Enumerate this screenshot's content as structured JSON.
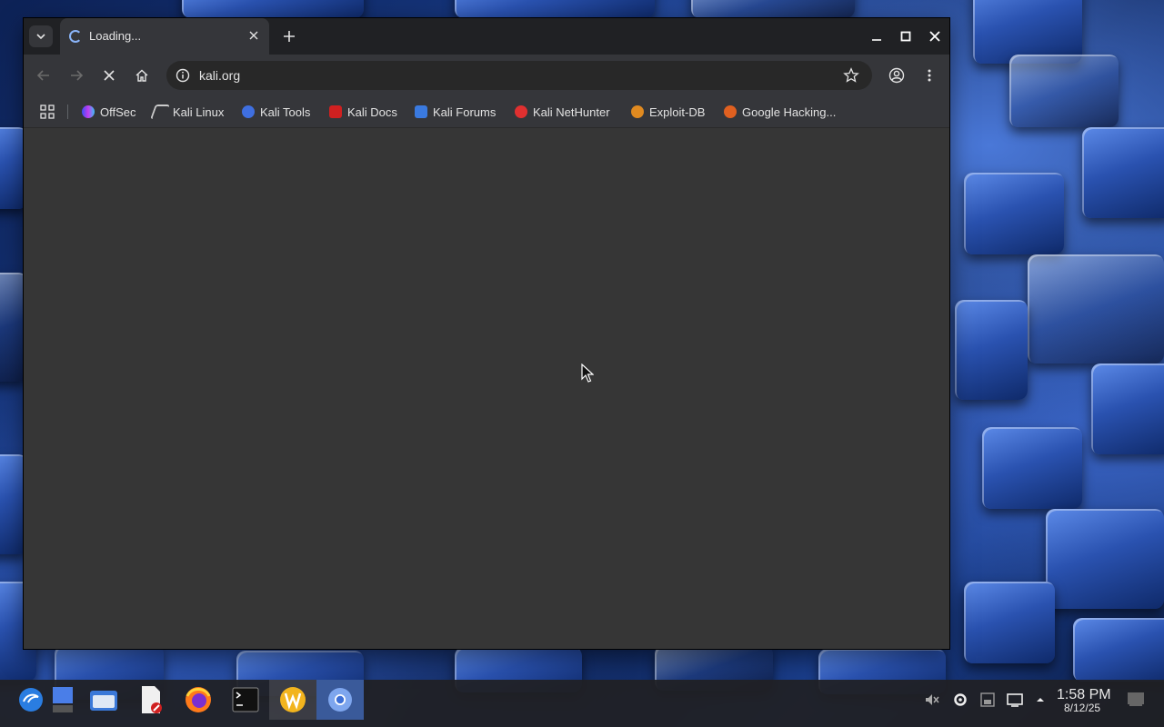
{
  "browser": {
    "tab": {
      "title": "Loading...",
      "close_icon": "close-icon"
    },
    "address": {
      "url": "kali.org"
    },
    "bookmarks": [
      {
        "label": "OffSec",
        "color": "#4a6cf7"
      },
      {
        "label": "Kali Linux",
        "color": "#cccccc"
      },
      {
        "label": "Kali Tools",
        "color": "#3f6fe0"
      },
      {
        "label": "Kali Docs",
        "color": "#d02020"
      },
      {
        "label": "Kali Forums",
        "color": "#3a7ae0"
      },
      {
        "label": "Kali NetHunter",
        "color": "#e03030"
      },
      {
        "label": "Exploit-DB",
        "color": "#e08a20"
      },
      {
        "label": "Google Hacking...",
        "color": "#e06020"
      }
    ]
  },
  "taskbar": {
    "apps": [
      {
        "name": "kali-menu-icon"
      },
      {
        "name": "show-desktop-icon"
      },
      {
        "name": "file-manager-icon"
      },
      {
        "name": "text-editor-icon"
      },
      {
        "name": "firefox-icon"
      },
      {
        "name": "terminal-icon"
      },
      {
        "name": "app-w-icon"
      },
      {
        "name": "chromium-icon"
      }
    ],
    "clock": {
      "time": "1:58 PM",
      "date": "8/12/25"
    }
  },
  "colors": {
    "accent": "#8ab4f8",
    "content_bg": "#363636",
    "toolbar_bg": "#35363a"
  }
}
